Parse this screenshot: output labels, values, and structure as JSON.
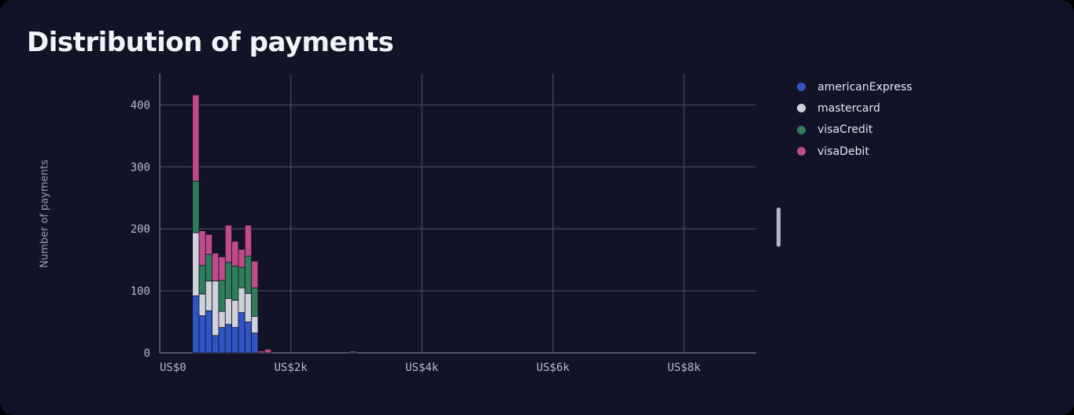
{
  "title": "Distribution of payments",
  "colors": {
    "panel": "#121326",
    "grid": "#3f4156",
    "axis": "#6a6c84",
    "bar_stroke": "#121326"
  },
  "chart_data": {
    "type": "bar",
    "stacked": true,
    "title": "Distribution of payments",
    "xlabel": "",
    "ylabel": "Number of payments",
    "x_unit": "US$",
    "xlim": [
      0,
      9100
    ],
    "ylim": [
      0,
      450
    ],
    "bin_width": 100,
    "grid": true,
    "legend_position": "right",
    "x_ticks": [
      {
        "value": 0,
        "label": "US$0"
      },
      {
        "value": 2000,
        "label": "US$2k"
      },
      {
        "value": 4000,
        "label": "US$4k"
      },
      {
        "value": 6000,
        "label": "US$6k"
      },
      {
        "value": 8000,
        "label": "US$8k"
      }
    ],
    "y_ticks": [
      {
        "value": 0,
        "label": "0"
      },
      {
        "value": 100,
        "label": "100"
      },
      {
        "value": 200,
        "label": "200"
      },
      {
        "value": 300,
        "label": "300"
      },
      {
        "value": 400,
        "label": "400"
      }
    ],
    "bins": [
      500,
      600,
      700,
      800,
      900,
      1000,
      1100,
      1200,
      1300,
      1400,
      1500,
      1600,
      1700,
      2900
    ],
    "series": [
      {
        "name": "americanExpress",
        "color": "#2f55c5",
        "values": [
          92,
          60,
          68,
          28,
          41,
          46,
          41,
          65,
          50,
          32,
          0,
          0,
          0,
          0
        ]
      },
      {
        "name": "mastercard",
        "color": "#cfd1dc",
        "values": [
          102,
          35,
          48,
          88,
          26,
          42,
          44,
          40,
          46,
          27,
          0,
          0,
          0,
          0
        ]
      },
      {
        "name": "visaCredit",
        "color": "#2f7d5a",
        "values": [
          83,
          46,
          43,
          0,
          50,
          58,
          55,
          33,
          60,
          46,
          0,
          0,
          0,
          3
        ]
      },
      {
        "name": "visaDebit",
        "color": "#c04b88",
        "values": [
          139,
          56,
          32,
          45,
          38,
          60,
          40,
          29,
          50,
          43,
          3,
          6,
          0,
          0
        ]
      }
    ]
  }
}
